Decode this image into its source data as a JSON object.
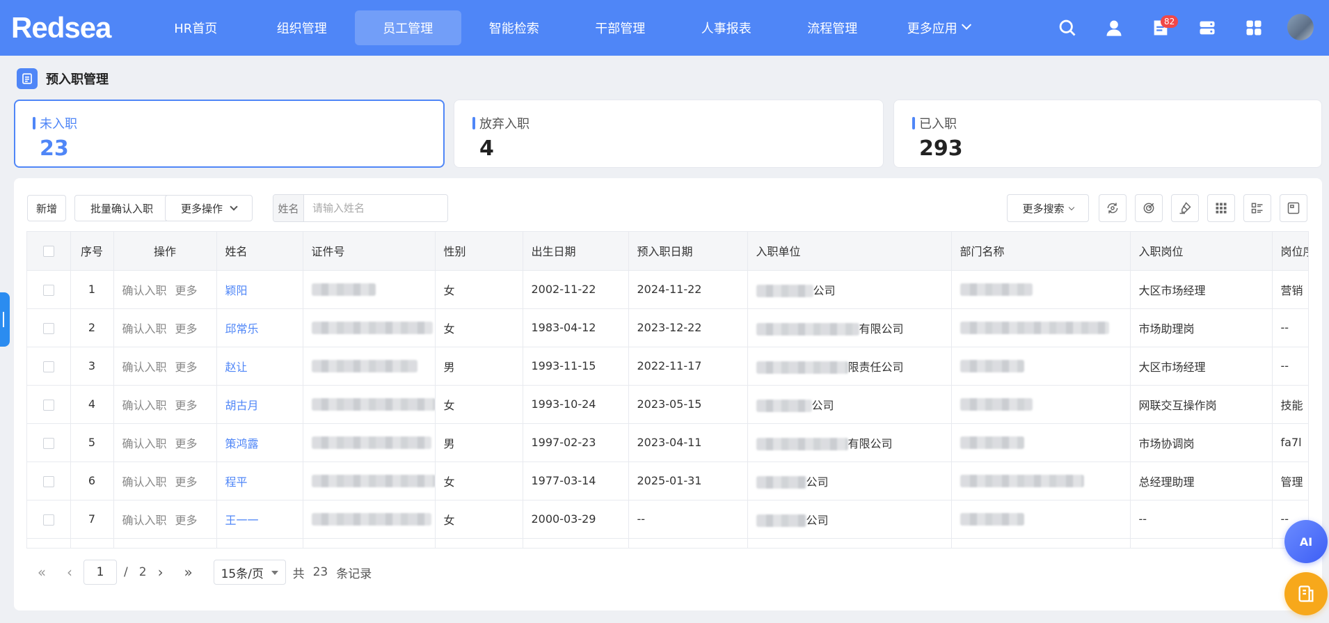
{
  "brand": {
    "logo_text": "Redsea"
  },
  "nav": {
    "items": [
      {
        "label": "HR首页"
      },
      {
        "label": "组织管理"
      },
      {
        "label": "员工管理"
      },
      {
        "label": "智能检索"
      },
      {
        "label": "干部管理"
      },
      {
        "label": "人事报表"
      },
      {
        "label": "流程管理"
      },
      {
        "label": "更多应用"
      }
    ],
    "active_index": 2,
    "notification_count": "82",
    "icons": [
      "search-icon",
      "user-icon",
      "message-icon",
      "server-icon",
      "apps-icon"
    ]
  },
  "page": {
    "title": "预入职管理"
  },
  "stats": [
    {
      "label": "未入职",
      "count": "23"
    },
    {
      "label": "放弃入职",
      "count": "4"
    },
    {
      "label": "已入职",
      "count": "293"
    }
  ],
  "toolbar": {
    "add_label": "新增",
    "batch_confirm_label": "批量确认入职",
    "more_ops_label": "更多操作",
    "search_label": "姓名",
    "search_placeholder": "请输入姓名",
    "search_value": "",
    "more_search_label": "更多搜索",
    "tool_icons": [
      "refresh-view-icon",
      "target-icon",
      "clear-filter-icon",
      "grid-icon",
      "list-settings-icon",
      "fullscreen-icon"
    ]
  },
  "table": {
    "columns": [
      "序号",
      "操作",
      "姓名",
      "证件号",
      "性别",
      "出生日期",
      "预入职日期",
      "入职单位",
      "部门名称",
      "入职岗位",
      "岗位序"
    ],
    "row_actions": {
      "confirm": "确认入职",
      "more": "更多"
    },
    "rows": [
      {
        "index": "1",
        "name": "颖阳",
        "gender": "女",
        "birth": "2002-11-22",
        "entry_date": "2024-11-22",
        "unit_suffix": "公司",
        "position": "大区市场经理",
        "sequence": "营销"
      },
      {
        "index": "2",
        "name": "邱常乐",
        "gender": "女",
        "birth": "1983-04-12",
        "entry_date": "2023-12-22",
        "unit_suffix": "有限公司",
        "position": "市场助理岗",
        "sequence": "--"
      },
      {
        "index": "3",
        "name": "赵让",
        "gender": "男",
        "birth": "1993-11-15",
        "entry_date": "2022-11-17",
        "unit_suffix": "限责任公司",
        "position": "大区市场经理",
        "sequence": "--"
      },
      {
        "index": "4",
        "name": "胡古月",
        "gender": "女",
        "birth": "1993-10-24",
        "entry_date": "2023-05-15",
        "unit_suffix": "公司",
        "position": "网联交互操作岗",
        "sequence": "技能"
      },
      {
        "index": "5",
        "name": "策鸿露",
        "gender": "男",
        "birth": "1997-02-23",
        "entry_date": "2023-04-11",
        "unit_suffix": "有限公司",
        "position": "市场协调岗",
        "sequence": "fa7l"
      },
      {
        "index": "6",
        "name": "程平",
        "gender": "女",
        "birth": "1977-03-14",
        "entry_date": "2025-01-31",
        "unit_suffix": "公司",
        "position": "总经理助理",
        "sequence": "管理"
      },
      {
        "index": "7",
        "name": "王一一",
        "gender": "女",
        "birth": "2000-03-29",
        "entry_date": "--",
        "unit_suffix": "公司",
        "position": "--",
        "sequence": "--"
      }
    ]
  },
  "pagination": {
    "current_page": "1",
    "separator": "/",
    "total_pages": "2",
    "page_size": "15条/页",
    "total_prefix": "共",
    "total_count": "23",
    "total_suffix": "条记录"
  },
  "widgets": {
    "ai_label": "AI"
  }
}
